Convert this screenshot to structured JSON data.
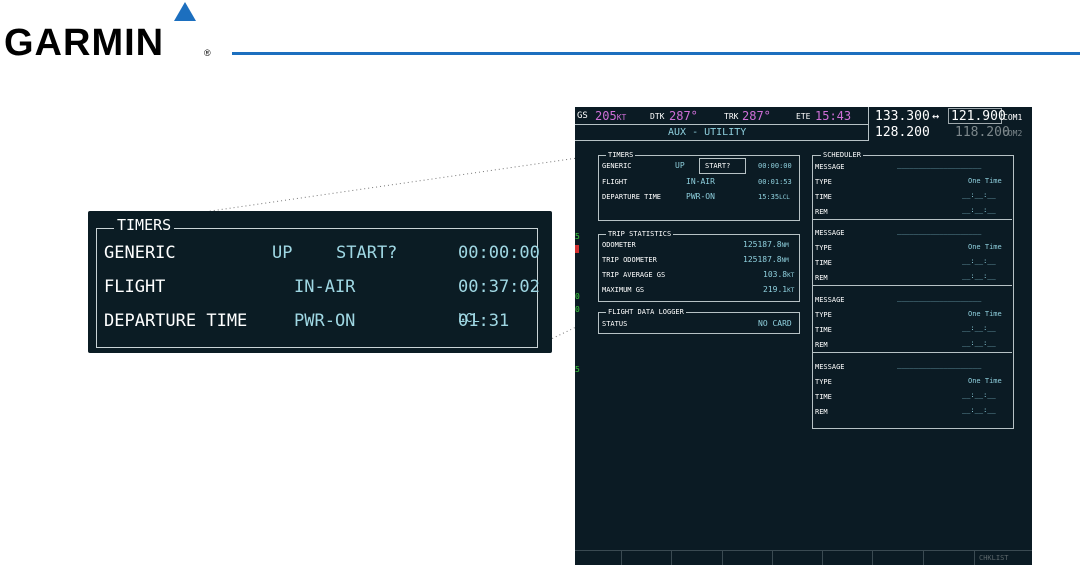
{
  "logo": {
    "text": "GARMIN",
    "reg": "®"
  },
  "zoom": {
    "title": "TIMERS",
    "rows": [
      {
        "label": "GENERIC",
        "mode": "UP",
        "action": "START?",
        "value": "00:00:00",
        "unit": ""
      },
      {
        "label": "FLIGHT",
        "mode": "",
        "action": "IN-AIR",
        "value": "00:37:02",
        "unit": ""
      },
      {
        "label": "DEPARTURE TIME",
        "mode": "",
        "action": "PWR-ON",
        "value": "01:31",
        "unit": "LCL"
      }
    ]
  },
  "topbar": {
    "gs_label": "GS",
    "gs_value": "205",
    "gs_unit": "KT",
    "dtk_label": "DTK",
    "dtk_value": "287°",
    "trk_label": "TRK",
    "trk_value": "287°",
    "ete_label": "ETE",
    "ete_value": "15:43",
    "page_title": "AUX - UTILITY"
  },
  "com": {
    "com1_standby": "133.300",
    "arrow": "↔",
    "com1_active": "121.900",
    "com1_label": "COM1",
    "com2_standby": "128.200",
    "com2_active": "118.200",
    "com2_label": "COM2"
  },
  "timers": {
    "title": "TIMERS",
    "generic_label": "GENERIC",
    "generic_mode": "UP",
    "generic_action": "START?",
    "generic_value": "00:00:00",
    "flight_label": "FLIGHT",
    "flight_mode": "IN-AIR",
    "flight_value": "00:01:53",
    "departure_label": "DEPARTURE TIME",
    "departure_mode": "PWR-ON",
    "departure_value": "15:35",
    "departure_unit": "LCL"
  },
  "trip": {
    "title": "TRIP STATISTICS",
    "rows": [
      {
        "label": "ODOMETER",
        "value": "125187.8",
        "unit": "NM"
      },
      {
        "label": "TRIP ODOMETER",
        "value": "125187.8",
        "unit": "NM"
      },
      {
        "label": "TRIP AVERAGE GS",
        "value": "103.8",
        "unit": "KT"
      },
      {
        "label": "MAXIMUM GS",
        "value": "219.1",
        "unit": "KT"
      }
    ]
  },
  "logger": {
    "title": "FLIGHT DATA LOGGER",
    "status_label": "STATUS",
    "status_value": "NO CARD"
  },
  "scheduler": {
    "title": "SCHEDULER",
    "message_label": "MESSAGE",
    "type_label": "TYPE",
    "time_label": "TIME",
    "rem_label": "REM",
    "type_value": "One Time",
    "message_value": "____________________",
    "time_value": "__:__:__",
    "rem_value": "__:__:__"
  },
  "softkeys": {
    "last_label": "CHKLIST"
  },
  "colors": {
    "mfd_bg": "#0b1b24",
    "cyan": "#8fd0de",
    "magenta": "#cf6fd8",
    "brand_blue": "#1c6fbf"
  }
}
